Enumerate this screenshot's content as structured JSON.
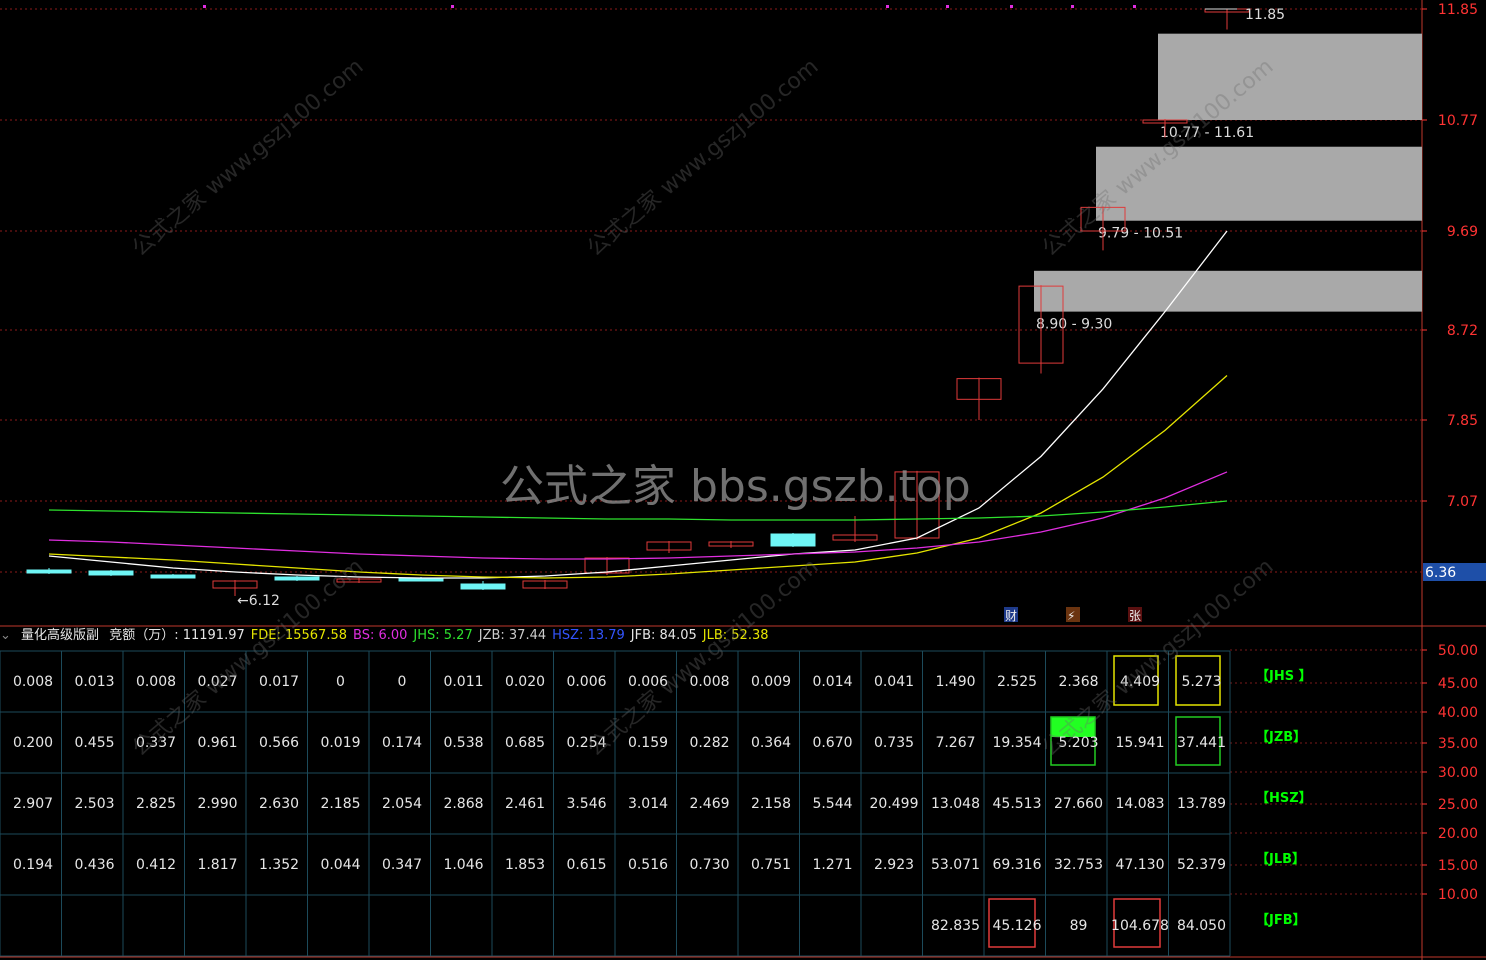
{
  "chart_data": {
    "type": "candlestick",
    "price_axis": {
      "ticks": [
        "11.85",
        "10.77",
        "9.69",
        "8.72",
        "7.85",
        "7.07",
        "6.36"
      ],
      "current_price": "6.36",
      "ylim": [
        6.3,
        11.85
      ]
    },
    "indicator_axis": {
      "ticks": [
        "50.00",
        "45.00",
        "40.00",
        "35.00",
        "30.00",
        "25.00",
        "20.00",
        "15.00",
        "10.00"
      ]
    },
    "candles": [
      {
        "o": 6.36,
        "c": 6.38,
        "h": 6.4,
        "l": 6.34,
        "color": "cyan"
      },
      {
        "o": 6.37,
        "c": 6.33,
        "h": 6.38,
        "l": 6.32,
        "color": "cyan"
      },
      {
        "o": 6.33,
        "c": 6.31,
        "h": 6.34,
        "l": 6.3,
        "color": "cyan"
      },
      {
        "o": 6.2,
        "c": 6.27,
        "h": 6.28,
        "l": 6.12,
        "color": "red"
      },
      {
        "o": 6.31,
        "c": 6.28,
        "h": 6.32,
        "l": 6.27,
        "color": "cyan"
      },
      {
        "o": 6.26,
        "c": 6.29,
        "h": 6.3,
        "l": 6.25,
        "color": "red"
      },
      {
        "o": 6.3,
        "c": 6.29,
        "h": 6.31,
        "l": 6.28,
        "color": "cyan"
      },
      {
        "o": 6.24,
        "c": 6.19,
        "h": 6.27,
        "l": 6.18,
        "color": "cyan"
      },
      {
        "o": 6.2,
        "c": 6.27,
        "h": 6.28,
        "l": 6.19,
        "color": "red"
      },
      {
        "o": 6.35,
        "c": 6.5,
        "h": 6.51,
        "l": 6.33,
        "color": "red"
      },
      {
        "o": 6.58,
        "c": 6.66,
        "h": 6.67,
        "l": 6.55,
        "color": "red"
      },
      {
        "o": 6.62,
        "c": 6.66,
        "h": 6.67,
        "l": 6.6,
        "color": "red"
      },
      {
        "o": 6.74,
        "c": 6.62,
        "h": 6.75,
        "l": 6.61,
        "color": "cyan"
      },
      {
        "o": 6.68,
        "c": 6.73,
        "h": 6.92,
        "l": 6.66,
        "color": "red"
      },
      {
        "o": 6.7,
        "c": 7.35,
        "h": 7.36,
        "l": 6.68,
        "color": "red"
      },
      {
        "o": 8.05,
        "c": 8.25,
        "h": 8.26,
        "l": 7.85,
        "color": "red"
      },
      {
        "o": 8.4,
        "c": 9.15,
        "h": 9.16,
        "l": 8.3,
        "color": "red"
      },
      {
        "o": 9.69,
        "c": 9.92,
        "h": 9.93,
        "l": 9.5,
        "color": "red"
      },
      {
        "o": 10.76,
        "c": 10.77,
        "h": 10.78,
        "l": 10.6,
        "color": "red"
      },
      {
        "o": 11.84,
        "c": 11.85,
        "h": 11.85,
        "l": 11.65,
        "color": "red"
      }
    ],
    "lines": [
      {
        "name": "white",
        "color": "#ffffff",
        "values": [
          6.52,
          6.46,
          6.4,
          6.36,
          6.33,
          6.31,
          6.3,
          6.3,
          6.32,
          6.36,
          6.42,
          6.48,
          6.54,
          6.58,
          6.7,
          7.0,
          7.5,
          8.15,
          8.9,
          9.69
        ]
      },
      {
        "name": "yellow",
        "color": "#e5e500",
        "values": [
          6.54,
          6.51,
          6.48,
          6.44,
          6.4,
          6.36,
          6.33,
          6.31,
          6.3,
          6.31,
          6.34,
          6.38,
          6.42,
          6.46,
          6.55,
          6.7,
          6.95,
          7.3,
          7.75,
          8.28
        ]
      },
      {
        "name": "magenta",
        "color": "#e02ee0",
        "values": [
          6.68,
          6.66,
          6.63,
          6.6,
          6.57,
          6.54,
          6.52,
          6.5,
          6.49,
          6.49,
          6.5,
          6.52,
          6.54,
          6.56,
          6.6,
          6.66,
          6.76,
          6.9,
          7.1,
          7.35
        ]
      },
      {
        "name": "green",
        "color": "#2ee22e",
        "values": [
          6.98,
          6.97,
          6.96,
          6.95,
          6.94,
          6.93,
          6.92,
          6.91,
          6.9,
          6.89,
          6.89,
          6.88,
          6.88,
          6.88,
          6.89,
          6.9,
          6.92,
          6.96,
          7.01,
          7.07
        ]
      }
    ],
    "zones": [
      {
        "label": "10.77 - 11.61",
        "low": 10.77,
        "high": 11.61
      },
      {
        "label": "9.79 - 10.51",
        "low": 9.79,
        "high": 10.51
      },
      {
        "label": "8.90 - 9.30",
        "low": 8.9,
        "high": 9.3
      }
    ],
    "annotations": {
      "high": "11.85",
      "low": "6.12"
    },
    "event_markers": [
      "财",
      "⚡",
      "张"
    ]
  },
  "status": {
    "title": "量化高级版副",
    "items": [
      {
        "text": "竞额（万）: 11191.97",
        "color": "#e6e6e6"
      },
      {
        "text": "FDE: 15567.58",
        "color": "#e5e500"
      },
      {
        "text": "BS: 6.00",
        "color": "#e02ee0"
      },
      {
        "text": "JHS: 5.27",
        "color": "#2ee22e"
      },
      {
        "text": "JZB: 37.44",
        "color": "#cccccc"
      },
      {
        "text": "HSZ: 13.79",
        "color": "#3355ff"
      },
      {
        "text": "JFB: 84.05",
        "color": "#e6e6e6"
      },
      {
        "text": "JLB: 52.38",
        "color": "#e5e500"
      }
    ]
  },
  "table": {
    "rows": [
      {
        "label": "【JHS 】",
        "values": [
          "0.008",
          "0.013",
          "0.008",
          "0.027",
          "0.017",
          "0",
          "0",
          "0.011",
          "0.020",
          "0.006",
          "0.006",
          "0.008",
          "0.009",
          "0.014",
          "0.041",
          "1.490",
          "2.525",
          "2.368",
          "4.409",
          "5.273"
        ]
      },
      {
        "label": "【JZB】",
        "values": [
          "0.200",
          "0.455",
          "0.337",
          "0.961",
          "0.566",
          "0.019",
          "0.174",
          "0.538",
          "0.685",
          "0.254",
          "0.159",
          "0.282",
          "0.364",
          "0.670",
          "0.735",
          "7.267",
          "19.354",
          "5.203",
          "15.941",
          "37.441"
        ]
      },
      {
        "label": "【HSZ】",
        "values": [
          "2.907",
          "2.503",
          "2.825",
          "2.990",
          "2.630",
          "2.185",
          "2.054",
          "2.868",
          "2.461",
          "3.546",
          "3.014",
          "2.469",
          "2.158",
          "5.544",
          "20.499",
          "13.048",
          "45.513",
          "27.660",
          "14.083",
          "13.789"
        ]
      },
      {
        "label": "【JLB】",
        "values": [
          "0.194",
          "0.436",
          "0.412",
          "1.817",
          "1.352",
          "0.044",
          "0.347",
          "1.046",
          "1.853",
          "0.615",
          "0.516",
          "0.730",
          "0.751",
          "1.271",
          "2.923",
          "53.071",
          "69.316",
          "32.753",
          "47.130",
          "52.379"
        ]
      },
      {
        "label": "【JFB】",
        "values": [
          "",
          "",
          "",
          "",
          "",
          "",
          "",
          "",
          "",
          "",
          "",
          "",
          "",
          "",
          "",
          "82.835",
          "45.126",
          "89",
          "104.678",
          "84.050"
        ]
      }
    ]
  },
  "watermark": {
    "center": "公式之家 bbs.gszb.top",
    "tile": "公式之家 www.gszj100.com"
  }
}
